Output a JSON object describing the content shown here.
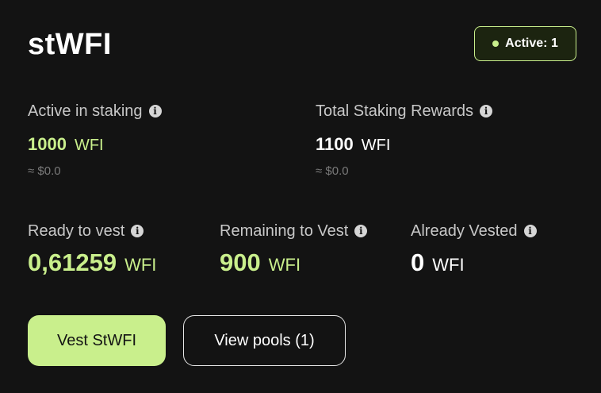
{
  "card": {
    "title": "stWFI",
    "status_badge": "Active: 1"
  },
  "stats": {
    "active": {
      "label": "Active in staking",
      "value": "1000",
      "unit": "WFI",
      "usd": "≈ $0.0"
    },
    "total": {
      "label": "Total Staking Rewards",
      "value": "1100",
      "unit": "WFI",
      "usd": "≈ $0.0"
    },
    "ready": {
      "label": "Ready to vest",
      "value": "0,61259",
      "unit": "WFI"
    },
    "remaining": {
      "label": "Remaining to Vest",
      "value": "900",
      "unit": "WFI"
    },
    "vested": {
      "label": "Already Vested",
      "value": "0",
      "unit": "WFI"
    }
  },
  "actions": {
    "vest_label": "Vest StWFI",
    "pools_label": "View pools (1)"
  },
  "icons": {
    "info": "info-icon",
    "status_dot": "status-dot-icon"
  },
  "colors": {
    "accent": "#c9ef8c",
    "background": "#131313",
    "text": "#ffffff",
    "muted": "#7a7a7a"
  }
}
